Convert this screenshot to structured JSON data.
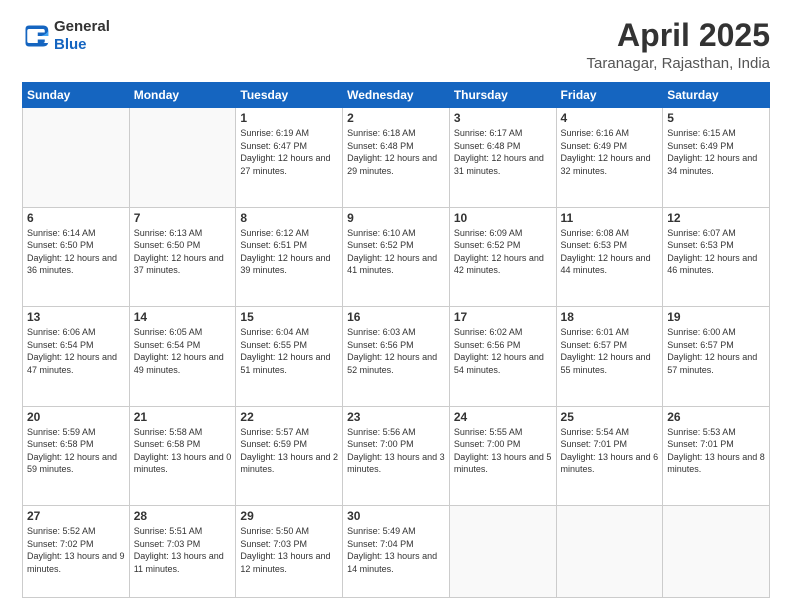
{
  "logo": {
    "line1": "General",
    "line2": "Blue"
  },
  "title": "April 2025",
  "location": "Taranagar, Rajasthan, India",
  "days_of_week": [
    "Sunday",
    "Monday",
    "Tuesday",
    "Wednesday",
    "Thursday",
    "Friday",
    "Saturday"
  ],
  "weeks": [
    [
      {
        "day": "",
        "info": ""
      },
      {
        "day": "",
        "info": ""
      },
      {
        "day": "1",
        "info": "Sunrise: 6:19 AM\nSunset: 6:47 PM\nDaylight: 12 hours\nand 27 minutes."
      },
      {
        "day": "2",
        "info": "Sunrise: 6:18 AM\nSunset: 6:48 PM\nDaylight: 12 hours\nand 29 minutes."
      },
      {
        "day": "3",
        "info": "Sunrise: 6:17 AM\nSunset: 6:48 PM\nDaylight: 12 hours\nand 31 minutes."
      },
      {
        "day": "4",
        "info": "Sunrise: 6:16 AM\nSunset: 6:49 PM\nDaylight: 12 hours\nand 32 minutes."
      },
      {
        "day": "5",
        "info": "Sunrise: 6:15 AM\nSunset: 6:49 PM\nDaylight: 12 hours\nand 34 minutes."
      }
    ],
    [
      {
        "day": "6",
        "info": "Sunrise: 6:14 AM\nSunset: 6:50 PM\nDaylight: 12 hours\nand 36 minutes."
      },
      {
        "day": "7",
        "info": "Sunrise: 6:13 AM\nSunset: 6:50 PM\nDaylight: 12 hours\nand 37 minutes."
      },
      {
        "day": "8",
        "info": "Sunrise: 6:12 AM\nSunset: 6:51 PM\nDaylight: 12 hours\nand 39 minutes."
      },
      {
        "day": "9",
        "info": "Sunrise: 6:10 AM\nSunset: 6:52 PM\nDaylight: 12 hours\nand 41 minutes."
      },
      {
        "day": "10",
        "info": "Sunrise: 6:09 AM\nSunset: 6:52 PM\nDaylight: 12 hours\nand 42 minutes."
      },
      {
        "day": "11",
        "info": "Sunrise: 6:08 AM\nSunset: 6:53 PM\nDaylight: 12 hours\nand 44 minutes."
      },
      {
        "day": "12",
        "info": "Sunrise: 6:07 AM\nSunset: 6:53 PM\nDaylight: 12 hours\nand 46 minutes."
      }
    ],
    [
      {
        "day": "13",
        "info": "Sunrise: 6:06 AM\nSunset: 6:54 PM\nDaylight: 12 hours\nand 47 minutes."
      },
      {
        "day": "14",
        "info": "Sunrise: 6:05 AM\nSunset: 6:54 PM\nDaylight: 12 hours\nand 49 minutes."
      },
      {
        "day": "15",
        "info": "Sunrise: 6:04 AM\nSunset: 6:55 PM\nDaylight: 12 hours\nand 51 minutes."
      },
      {
        "day": "16",
        "info": "Sunrise: 6:03 AM\nSunset: 6:56 PM\nDaylight: 12 hours\nand 52 minutes."
      },
      {
        "day": "17",
        "info": "Sunrise: 6:02 AM\nSunset: 6:56 PM\nDaylight: 12 hours\nand 54 minutes."
      },
      {
        "day": "18",
        "info": "Sunrise: 6:01 AM\nSunset: 6:57 PM\nDaylight: 12 hours\nand 55 minutes."
      },
      {
        "day": "19",
        "info": "Sunrise: 6:00 AM\nSunset: 6:57 PM\nDaylight: 12 hours\nand 57 minutes."
      }
    ],
    [
      {
        "day": "20",
        "info": "Sunrise: 5:59 AM\nSunset: 6:58 PM\nDaylight: 12 hours\nand 59 minutes."
      },
      {
        "day": "21",
        "info": "Sunrise: 5:58 AM\nSunset: 6:58 PM\nDaylight: 13 hours\nand 0 minutes."
      },
      {
        "day": "22",
        "info": "Sunrise: 5:57 AM\nSunset: 6:59 PM\nDaylight: 13 hours\nand 2 minutes."
      },
      {
        "day": "23",
        "info": "Sunrise: 5:56 AM\nSunset: 7:00 PM\nDaylight: 13 hours\nand 3 minutes."
      },
      {
        "day": "24",
        "info": "Sunrise: 5:55 AM\nSunset: 7:00 PM\nDaylight: 13 hours\nand 5 minutes."
      },
      {
        "day": "25",
        "info": "Sunrise: 5:54 AM\nSunset: 7:01 PM\nDaylight: 13 hours\nand 6 minutes."
      },
      {
        "day": "26",
        "info": "Sunrise: 5:53 AM\nSunset: 7:01 PM\nDaylight: 13 hours\nand 8 minutes."
      }
    ],
    [
      {
        "day": "27",
        "info": "Sunrise: 5:52 AM\nSunset: 7:02 PM\nDaylight: 13 hours\nand 9 minutes."
      },
      {
        "day": "28",
        "info": "Sunrise: 5:51 AM\nSunset: 7:03 PM\nDaylight: 13 hours\nand 11 minutes."
      },
      {
        "day": "29",
        "info": "Sunrise: 5:50 AM\nSunset: 7:03 PM\nDaylight: 13 hours\nand 12 minutes."
      },
      {
        "day": "30",
        "info": "Sunrise: 5:49 AM\nSunset: 7:04 PM\nDaylight: 13 hours\nand 14 minutes."
      },
      {
        "day": "",
        "info": ""
      },
      {
        "day": "",
        "info": ""
      },
      {
        "day": "",
        "info": ""
      }
    ]
  ]
}
